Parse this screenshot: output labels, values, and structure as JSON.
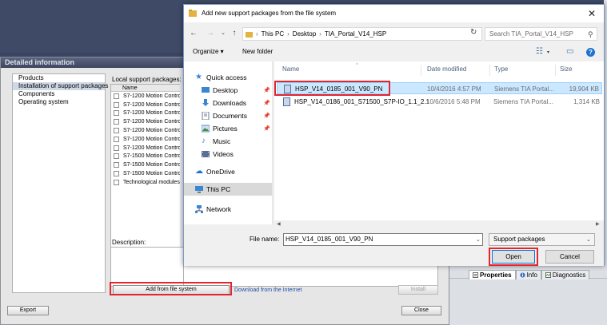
{
  "tia": {
    "tabs": [
      {
        "label": "Properties",
        "icon": "properties-icon"
      },
      {
        "label": "Info",
        "icon": "info-icon"
      },
      {
        "label": "Diagnostics",
        "icon": "diagnostics-icon"
      }
    ]
  },
  "detail_dialog": {
    "title": "Detailed information",
    "tree": [
      "Products",
      "Installation of support packages",
      "Components",
      "Operating system"
    ],
    "local_label": "Local support packages:",
    "list_header": "Name",
    "packages": [
      "S7-1200 Motion Control",
      "S7-1200 Motion Control",
      "S7-1200 Motion Control",
      "S7-1200 Motion Control",
      "S7-1200 Motion Control",
      "S7-1200 Motion Control",
      "S7-1200 Motion Control",
      "S7-1500 Motion Control",
      "S7-1500 Motion Control",
      "S7-1500 Motion Control",
      "Technological modules"
    ],
    "description_label": "Description:",
    "add_button": "Add from file system",
    "download_link": "Download from the Internet",
    "install_button": "Install",
    "export_button": "Export",
    "close_button": "Close"
  },
  "file_dialog": {
    "title": "Add new support packages from the file system",
    "breadcrumb": [
      "This PC",
      "Desktop",
      "TIA_Portal_V14_HSP"
    ],
    "search_placeholder": "Search TIA_Portal_V14_HSP",
    "organize": "Organize ▾",
    "new_folder": "New folder",
    "nav": {
      "quick_access": "Quick access",
      "items": [
        "Desktop",
        "Downloads",
        "Documents",
        "Pictures",
        "Music",
        "Videos"
      ],
      "onedrive": "OneDrive",
      "this_pc": "This PC",
      "network": "Network"
    },
    "columns": {
      "name": "Name",
      "date": "Date modified",
      "type": "Type",
      "size": "Size"
    },
    "files": [
      {
        "name": "HSP_V14_0185_001_V90_PN",
        "date": "10/4/2016 4:57 PM",
        "type": "Siemens TIA Portal...",
        "size": "19,904 KB"
      },
      {
        "name": "HSP_V14_0186_001_S71500_S7P-IO_1.1_2.1",
        "date": "10/6/2016 5:48 PM",
        "type": "Siemens TIA Portal...",
        "size": "1,314 KB"
      }
    ],
    "file_name_label": "File name:",
    "file_name_value": "HSP_V14_0185_001_V90_PN",
    "file_type": "Support packages",
    "open_button": "Open",
    "cancel_button": "Cancel"
  },
  "colors": {
    "highlight": "#e5252e",
    "selection": "#cce8ff",
    "accent": "#0078d7"
  }
}
